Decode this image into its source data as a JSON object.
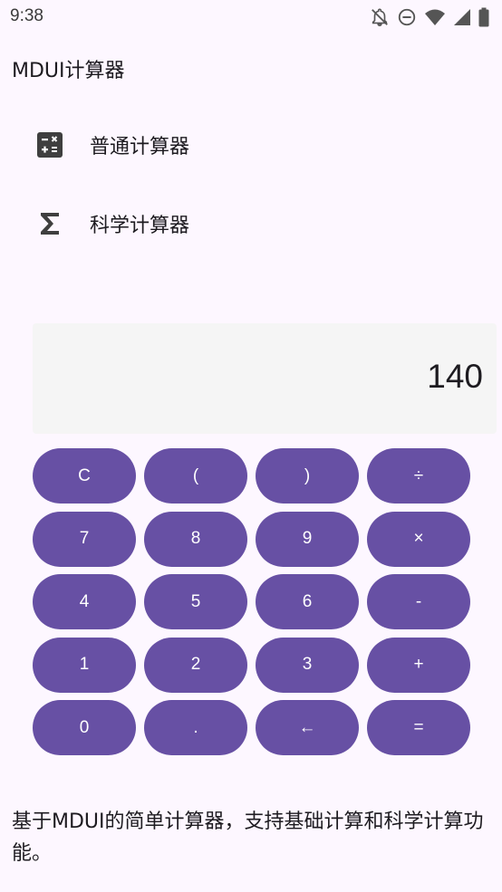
{
  "status_bar": {
    "time": "9:38",
    "icons": [
      "bell-off-icon",
      "do-not-disturb-icon",
      "wifi-icon",
      "signal-icon",
      "battery-icon"
    ]
  },
  "app": {
    "title": "MDUI计算器"
  },
  "nav": {
    "items": [
      {
        "label": "普通计算器",
        "icon": "calculator-icon"
      },
      {
        "label": "科学计算器",
        "icon": "sigma-icon"
      }
    ]
  },
  "calculator": {
    "display_value": "140",
    "keys": [
      "C",
      "(",
      ")",
      "÷",
      "7",
      "8",
      "9",
      "×",
      "4",
      "5",
      "6",
      "-",
      "1",
      "2",
      "3",
      "+",
      "0",
      ".",
      "←",
      "="
    ]
  },
  "footer": {
    "description": "基于MDUI的简单计算器，支持基础计算和科学计算功能。"
  },
  "colors": {
    "background": "#fdf7ff",
    "primary": "#6750a4",
    "display_bg": "#f5f5f5",
    "text": "#1d1b20"
  }
}
